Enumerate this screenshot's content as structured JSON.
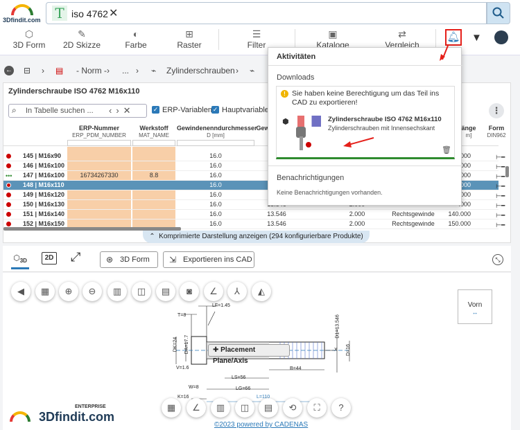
{
  "header": {
    "logo": "3Dfindit.com",
    "search_value": "iso 4762"
  },
  "toolbar": {
    "items": [
      "3D Form",
      "2D Skizze",
      "Farbe",
      "Raster",
      "Filter",
      "Kataloge",
      "Vergleich"
    ]
  },
  "breadcrumb": {
    "items": [
      "- Norm -",
      "...",
      "Zylinderschrauben"
    ]
  },
  "table": {
    "title": "Zylinderschraube ISO 4762 M16x110",
    "search_placeholder": "In Tabelle suchen ...",
    "checkbox1": "ERP-Variablen",
    "checkbox2": "Hauptvariablen",
    "columns": [
      {
        "title": "ERP-Nummer",
        "sub": "ERP_PDM_NUMBER"
      },
      {
        "title": "Werkstoff",
        "sub": "MAT_NAME"
      },
      {
        "title": "Gewindenenndurchmesser",
        "sub": "D [mm]"
      },
      {
        "title": "Gew",
        "sub": ""
      },
      {
        "title": "änge",
        "sub": "m]"
      },
      {
        "title": "Form",
        "sub": "DIN962"
      }
    ],
    "rows": [
      {
        "pos": "145 | M16x90",
        "erp": "",
        "mat": "",
        "d": "16.0",
        "c4": "",
        "c5": "",
        "c6": ".000"
      },
      {
        "pos": "146 | M16x100",
        "erp": "",
        "mat": "",
        "d": "16.0",
        "c4": "",
        "c5": "",
        "c6": ".000"
      },
      {
        "pos": "147 | M16x100",
        "erp": "16734267330",
        "mat": "8.8",
        "d": "16.0",
        "c4": "",
        "c5": "",
        "c6": ".000"
      },
      {
        "pos": "148 | M16x110",
        "erp": "",
        "mat": "",
        "d": "16.0",
        "c4": "",
        "c5": "",
        "c6": ".000"
      },
      {
        "pos": "149 | M16x120",
        "erp": "",
        "mat": "",
        "d": "16.0",
        "c4": "",
        "c5": "",
        "c6": ".000"
      },
      {
        "pos": "150 | M16x130",
        "erp": "",
        "mat": "",
        "d": "16.0",
        "c4": "13.546",
        "c5": "2.000",
        "c6": ".000"
      },
      {
        "pos": "151 | M16x140",
        "erp": "",
        "mat": "",
        "d": "16.0",
        "c4": "13.546",
        "c5": "2.000",
        "c5b": "Rechtsgewinde",
        "c6": "140.000"
      },
      {
        "pos": "152 | M16x150",
        "erp": "",
        "mat": "",
        "d": "16.0",
        "c4": "13.546",
        "c5": "2.000",
        "c5b": "Rechtsgewinde",
        "c6": "150.000"
      }
    ],
    "compressed_label": "Komprimierte Darstellung anzeigen (294 konfigurierbare Produkte)"
  },
  "popup": {
    "title": "Aktivitäten",
    "downloads_label": "Downloads",
    "warning": "Sie haben keine Berechtigung um das Teil ins CAD zu exportieren!",
    "product_title": "Zylinderschraube ISO 4762 M16x110",
    "product_sub": "Zylinderschrauben mit Innensechskant",
    "notifications_label": "Benachrichtigungen",
    "notifications_empty": "Keine Benachrichtigungen vorhanden."
  },
  "viewer": {
    "tab_3d": "3D",
    "tab_2d": "2D",
    "btn_3dform": "3D Form",
    "btn_export": "Exportieren ins CAD",
    "view_label": "Vorn",
    "placement": "Placement Plane/Axis",
    "footer": "©2023 powered by CADENAS",
    "brand_small": "ENTERPRISE",
    "brand": "3Dfindit.com",
    "dims": [
      "LF=1.45",
      "T=8",
      "DK=24",
      "DA=17.7",
      "V=1.6",
      "LS=56",
      "B=44",
      "LG=66",
      "W=8",
      "K=16",
      "D1=13.546",
      "D=16",
      "L=110",
      "X"
    ]
  },
  "colors": {
    "accent": "#2b79b8",
    "selected_row": "#5b93b8",
    "erp_highlight": "#f8cfa8",
    "alert": "#e5201a"
  }
}
